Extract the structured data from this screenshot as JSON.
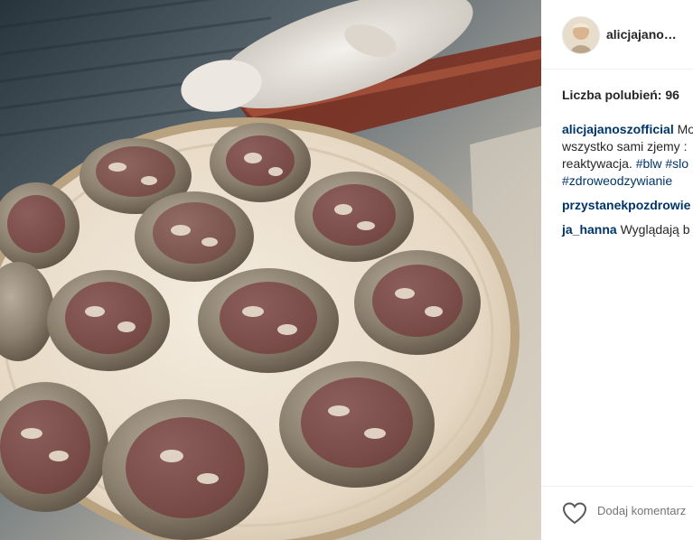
{
  "post": {
    "username": "alicjajano…",
    "likes_text": "Liczba polubień: 96"
  },
  "comments": [
    {
      "lines": [
        [
          {
            "kind": "user",
            "text": "alicjajanoszofficial"
          },
          {
            "kind": "text",
            "text": " Mo"
          }
        ],
        [
          {
            "kind": "text",
            "text": "wszystko sami zjemy :"
          }
        ],
        [
          {
            "kind": "text",
            "text": "reaktywacja. "
          },
          {
            "kind": "tag",
            "text": "#blw"
          },
          {
            "kind": "text",
            "text": " "
          },
          {
            "kind": "tag",
            "text": "#slo"
          }
        ],
        [
          {
            "kind": "tag",
            "text": "#zdroweodzywianie"
          }
        ]
      ]
    },
    {
      "lines": [
        [
          {
            "kind": "user",
            "text": "przystanekpozdrowie"
          }
        ]
      ]
    },
    {
      "lines": [
        [
          {
            "kind": "user",
            "text": "ja_hanna"
          },
          {
            "kind": "text",
            "text": " Wyglądają b"
          }
        ]
      ]
    }
  ],
  "footer": {
    "like_icon": "heart-outline-icon",
    "comment_placeholder": "Dodaj komentarz"
  },
  "photo": {
    "subject": "muffins-on-tray-image"
  }
}
